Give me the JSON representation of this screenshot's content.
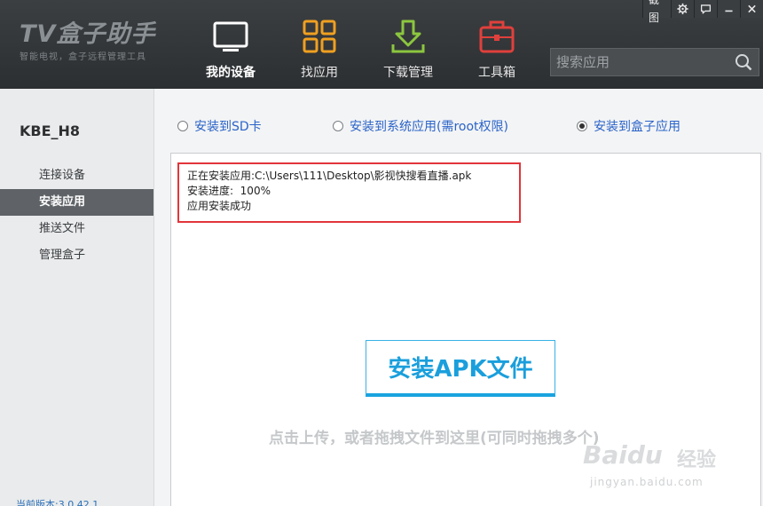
{
  "app": {
    "logo_title": "TV盒子助手",
    "logo_subtitle": "智能电视，盒子远程管理工具"
  },
  "top_controls": {
    "screenshot_label": "截图",
    "settings_icon": "gear-icon",
    "feedback_icon": "chat-icon",
    "minimize_icon": "minimize-icon",
    "close_icon": "close-icon"
  },
  "nav": {
    "items": [
      {
        "label": "我的设备",
        "icon": "monitor-icon",
        "active": true
      },
      {
        "label": "找应用",
        "icon": "grid-icon",
        "active": false
      },
      {
        "label": "下载管理",
        "icon": "download-icon",
        "active": false
      },
      {
        "label": "工具箱",
        "icon": "toolbox-icon",
        "active": false
      }
    ]
  },
  "search": {
    "placeholder": "搜索应用",
    "value": ""
  },
  "sidebar": {
    "device_name": "KBE_H8",
    "items": [
      {
        "label": "连接设备",
        "active": false
      },
      {
        "label": "安装应用",
        "active": true
      },
      {
        "label": "推送文件",
        "active": false
      },
      {
        "label": "管理盒子",
        "active": false
      }
    ],
    "version": "当前版本:3.0.42.1"
  },
  "install_options": [
    {
      "label": "安装到SD卡",
      "checked": false
    },
    {
      "label": "安装到系统应用(需root权限)",
      "checked": false
    },
    {
      "label": "安装到盒子应用",
      "checked": true
    }
  ],
  "status": {
    "line1": "正在安装应用:C:\\Users\\111\\Desktop\\影视快搜看直播.apk",
    "line2": "安装进度:  100%",
    "line3": "应用安装成功"
  },
  "install_button_label": "安装APK文件",
  "hint": "点击上传，或者拖拽文件到这里(可同时拖拽多个)",
  "watermark": {
    "logo": "Baidu",
    "logo2": "经验",
    "url": "jingyan.baidu.com"
  },
  "colors": {
    "header_bg": "#33373a",
    "accent_blue": "#1a9fdc",
    "link_blue": "#2a63c9",
    "highlight_red": "#e2353b",
    "icon_orange": "#f0a020",
    "icon_green": "#8cc63f",
    "icon_red": "#e0403c"
  }
}
